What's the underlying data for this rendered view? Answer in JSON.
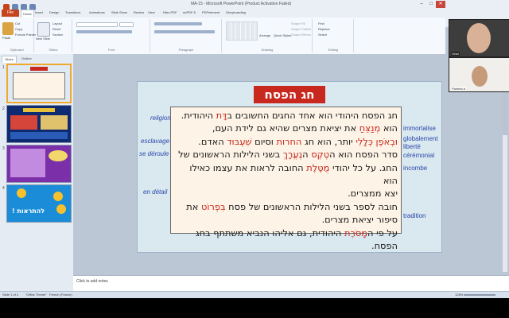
{
  "window": {
    "title": "MA-15 - Microsoft PowerPoint (Product Activation Failed)",
    "controls": [
      "–",
      "□",
      "✕"
    ]
  },
  "ribbon": {
    "file_tab": "File",
    "tabs": [
      "Home",
      "Insert",
      "Design",
      "Transitions",
      "Animations",
      "Slide Show",
      "Review",
      "View",
      "Nitro PDF",
      "doPDF 8",
      "PDFelement",
      "Storyboarding"
    ],
    "groups": [
      "Clipboard",
      "Slides",
      "Font",
      "Paragraph",
      "Drawing",
      "Editing"
    ],
    "clipboard": {
      "paste": "Paste",
      "cut": "Cut",
      "copy": "Copy",
      "format_painter": "Format Painter"
    },
    "slides": {
      "new_slide": "New Slide",
      "layout": "Layout",
      "reset": "Reset",
      "section": "Section"
    },
    "drawing": {
      "arrange": "Arrange",
      "quick_styles": "Quick Styles",
      "shape_fill": "Shape Fill",
      "shape_outline": "Shape Outline",
      "shape_effects": "Shape Effects"
    },
    "editing": {
      "find": "Find",
      "replace": "Replace",
      "select": "Select"
    }
  },
  "left_panel": {
    "tabs": [
      "Slides",
      "Outline"
    ],
    "thumbnails": [
      {
        "number": "1"
      },
      {
        "number": "2"
      },
      {
        "number": "3"
      },
      {
        "number": "4",
        "text": "להתראות !"
      }
    ]
  },
  "slide": {
    "title": "חג הפסח",
    "body_lines": [
      [
        {
          "t": "חג הפסח היהודי הוא אחד החגים החשובים ב"
        },
        {
          "t": "דָּת",
          "hl": true
        },
        {
          "t": " היהודית."
        }
      ],
      [
        {
          "t": "הוא "
        },
        {
          "t": "מְנַצֵּחַ",
          "hl": true
        },
        {
          "t": " את יציאת מצרים שהיא גם לידת העם,"
        }
      ],
      [
        {
          "t": "וּבְאֹפֶן כְּלָלִי",
          "hl": true
        },
        {
          "t": " יותר, הוא חג "
        },
        {
          "t": "החרות",
          "hl": true
        },
        {
          "t": " וסיום "
        },
        {
          "t": "שִׁעְבּוּד",
          "hl": true
        },
        {
          "t": " האדם."
        }
      ],
      [
        {
          "t": "סדר הפסח הוא ה"
        },
        {
          "t": "טֶקֶס",
          "hl": true
        },
        {
          "t": " ה"
        },
        {
          "t": "נֶעֱרָךְ",
          "hl": true
        },
        {
          "t": " בשני הלילות הראשונים של"
        }
      ],
      [
        {
          "t": "החג. על כל יהודי "
        },
        {
          "t": "מֻטֶּלֶת",
          "hl": true
        },
        {
          "t": " החובה לראות את עצמו כאילו הוא"
        }
      ],
      [
        {
          "t": "יצא ממצרים."
        }
      ],
      [
        {
          "t": "חובה לספר בשני הלילות הראשונים של פסח "
        },
        {
          "t": "בִּפְרוֹט",
          "hl": true
        },
        {
          "t": " את"
        }
      ],
      [
        {
          "t": "סיפור יציאת מצרים."
        }
      ],
      [
        {
          "t": "על פי ה"
        },
        {
          "t": "מָסֹרֶת",
          "hl": true
        },
        {
          "t": " היהודית, גם אליהו הנביא משתתף בחג"
        }
      ],
      [
        {
          "t": "הפסח."
        }
      ]
    ],
    "glosses_left": [
      "religion",
      "esclavage",
      "se déroule",
      "en détail"
    ],
    "glosses_right": [
      "immortalise",
      "globalement",
      "liberté",
      "cérémonial",
      "incombe",
      "tradition"
    ]
  },
  "notes": {
    "placeholder": "Click to add notes"
  },
  "status": {
    "slide_info": "Slide 1 of 4",
    "theme": "\"Office Theme\"",
    "language": "French (France)",
    "zoom": "128%"
  },
  "video": [
    {
      "name": "Ortal"
    },
    {
      "name": "Palmira a"
    }
  ],
  "colors": {
    "accent_red": "#c8281e",
    "gloss_blue": "#2a48a8",
    "file_tab": "#c5441b",
    "text_box_bg": "#fdf3e6"
  }
}
